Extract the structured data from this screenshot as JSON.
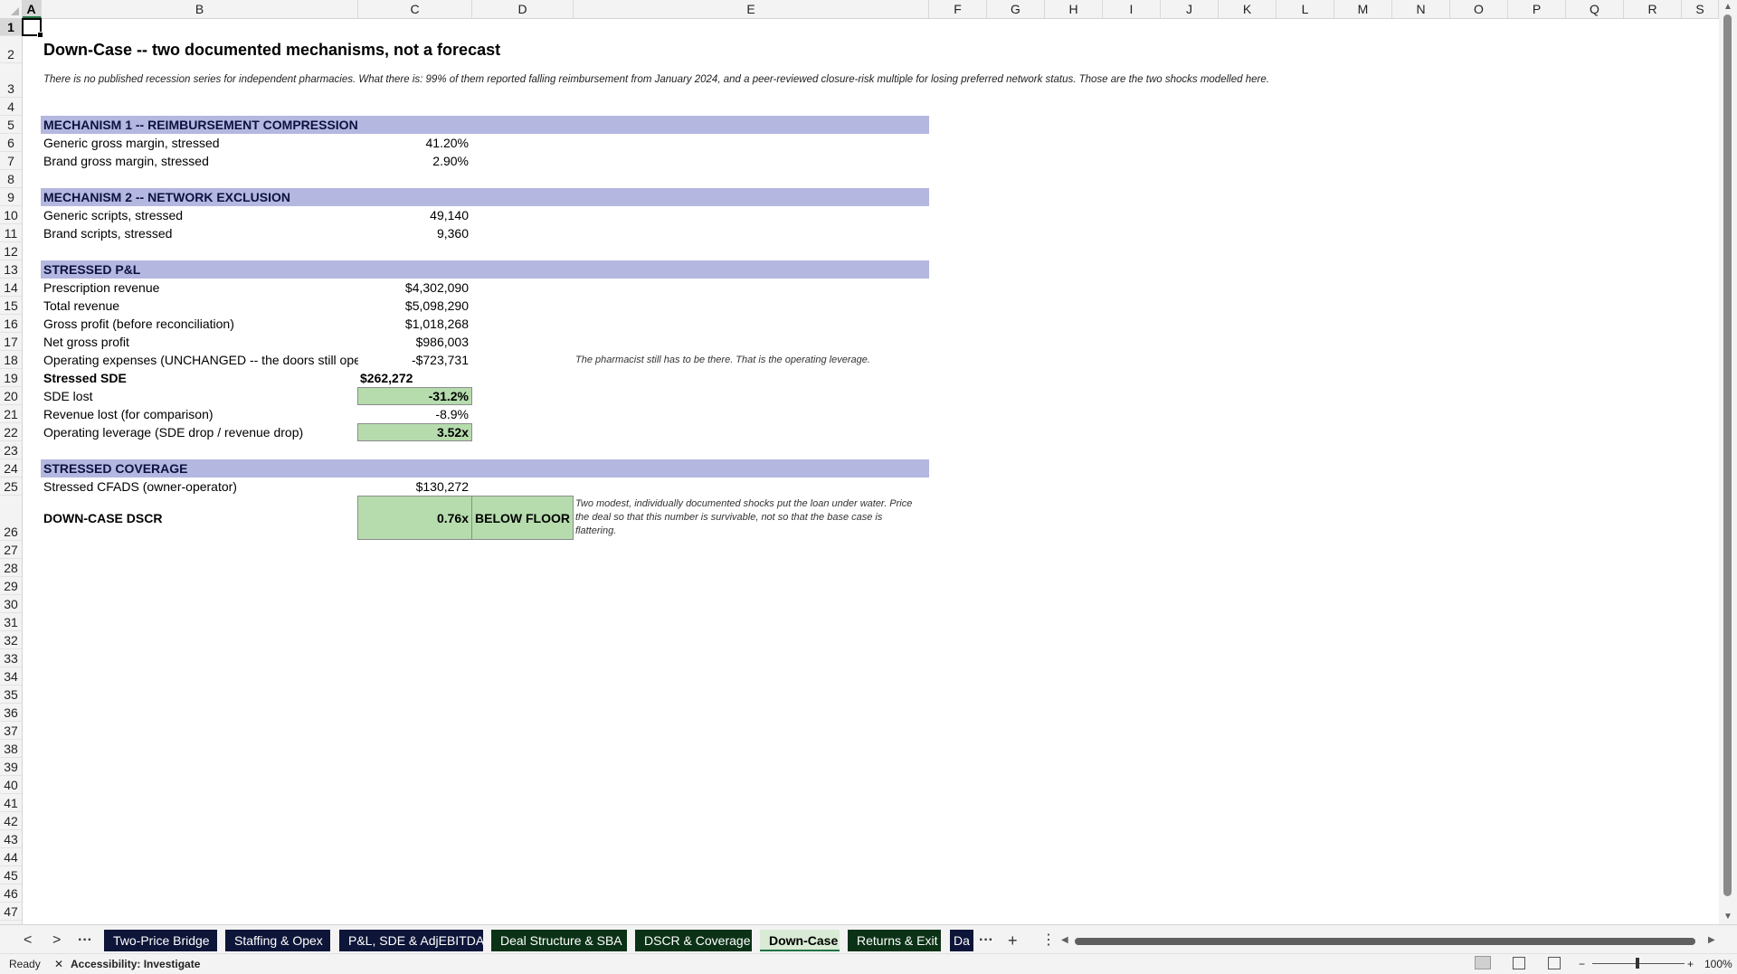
{
  "columns": [
    "A",
    "B",
    "C",
    "D",
    "E",
    "F",
    "G",
    "H",
    "I",
    "J",
    "K",
    "L",
    "M",
    "N",
    "O",
    "P",
    "Q",
    "R",
    "S"
  ],
  "rows": [
    "1",
    "2",
    "3",
    "4",
    "5",
    "6",
    "7",
    "8",
    "9",
    "10",
    "11",
    "12",
    "13",
    "14",
    "15",
    "16",
    "17",
    "18",
    "19",
    "20",
    "21",
    "22",
    "23",
    "24",
    "25",
    "26",
    "27",
    "28",
    "29",
    "30",
    "31",
    "32",
    "33",
    "34",
    "35",
    "36",
    "37",
    "38",
    "39",
    "40",
    "41",
    "42",
    "43",
    "44",
    "45",
    "46",
    "47"
  ],
  "sheet": {
    "title": "Down-Case -- two documented mechanisms, not a forecast",
    "intro": "There is no published recession series for independent pharmacies. What there is: 99% of them reported falling reimbursement from January 2024, and a peer-reviewed closure-risk multiple for losing preferred network status. Those are the two shocks modelled here.",
    "mech1": {
      "header": "MECHANISM 1 -- REIMBURSEMENT COMPRESSION",
      "generic_label": "Generic gross margin, stressed",
      "generic_value": "41.20%",
      "brand_label": "Brand gross margin, stressed",
      "brand_value": "2.90%"
    },
    "mech2": {
      "header": "MECHANISM 2 -- NETWORK EXCLUSION",
      "generic_label": "Generic scripts, stressed",
      "generic_value": "49,140",
      "brand_label": "Brand scripts, stressed",
      "brand_value": "9,360"
    },
    "pl": {
      "header": "STRESSED P&L",
      "rx_label": "Prescription revenue",
      "rx_value": "$4,302,090",
      "tot_label": "Total revenue",
      "tot_value": "$5,098,290",
      "gp_label": "Gross profit (before reconciliation)",
      "gp_value": "$1,018,268",
      "ngp_label": "Net gross profit",
      "ngp_value": "$986,003",
      "opex_label": "Operating expenses (UNCHANGED -- the doors still open",
      "opex_value": "-$723,731",
      "opex_note": "The pharmacist still has to be there. That is the operating leverage.",
      "sde_label": "Stressed SDE",
      "sde_value": "$262,272",
      "sdelost_label": "SDE lost",
      "sdelost_value": "-31.2%",
      "revlost_label": "Revenue lost (for comparison)",
      "revlost_value": "-8.9%",
      "lev_label": "Operating leverage (SDE drop / revenue drop)",
      "lev_value": "3.52x"
    },
    "cov": {
      "header": "STRESSED COVERAGE",
      "cfads_label": "Stressed CFADS (owner-operator)",
      "cfads_value": "$130,272",
      "dscr_label": "DOWN-CASE DSCR",
      "dscr_value": "0.76x",
      "dscr_flag": "BELOW FLOOR",
      "dscr_note": "Two modest, individually documented shocks put the loan under water. Price the deal so that this number is survivable, not so that the base case is flattering."
    }
  },
  "tabs": [
    "Two-Price Bridge",
    "Staffing & Opex",
    "P&L, SDE & AdjEBITDA",
    "Deal Structure & SBA",
    "DSCR & Coverage",
    "Down-Case",
    "Returns & Exit",
    "Da"
  ],
  "tabbar": {
    "prev": "<",
    "next": ">",
    "more_left": "···",
    "more_right": "···",
    "add": "+",
    "options": "⋮"
  },
  "status": {
    "ready": "Ready",
    "accessibility": "Accessibility: Investigate",
    "zoom": "100%",
    "zoom_minus": "−",
    "zoom_plus": "+"
  },
  "colors": {
    "band": "#b4b7e0",
    "highlight": "#b6dcae",
    "tab_blue": "#0d1538",
    "tab_green": "#0b3216",
    "accent": "#217346"
  }
}
